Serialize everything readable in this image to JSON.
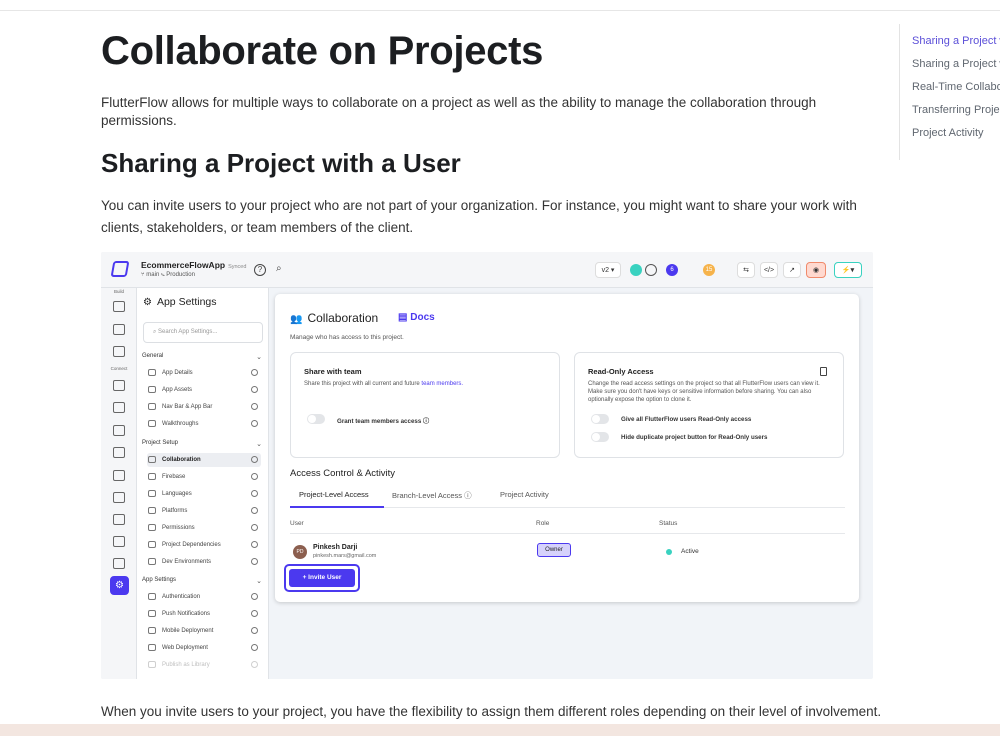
{
  "doc": {
    "title": "Collaborate on Projects",
    "intro": "FlutterFlow allows for multiple ways to collaborate on a project as well as the ability to manage the collaboration through permissions.",
    "section_title": "Sharing a Project with a User",
    "section_text": "You can invite users to your project who are not part of your organization. For instance, you might want to share your work with clients, stakeholders, or team members of the client.",
    "after_text": "When you invite users to your project, you have the flexibility to assign them different roles depending on their level of involvement."
  },
  "toc": {
    "items": [
      "Sharing a Project w",
      "Sharing a Project w",
      "Real-Time Collabor",
      "Transferring Projec",
      "Project Activity"
    ]
  },
  "app": {
    "name": "EcommerceFlowApp",
    "synced": "Synced",
    "branch": "main",
    "env": "Production",
    "version": "v2",
    "badge1": "6",
    "badge2": "15",
    "rail": {
      "build": "Build",
      "connect": "Connect"
    },
    "sidebar": {
      "title": "App Settings",
      "search_placeholder": "Search App Settings...",
      "sections": {
        "general": "General",
        "project_setup": "Project Setup",
        "app_settings": "App Settings"
      },
      "general_items": [
        "App Details",
        "App Assets",
        "Nav Bar & App Bar",
        "Walkthroughs"
      ],
      "setup_items": [
        "Collaboration",
        "Firebase",
        "Languages",
        "Platforms",
        "Permissions",
        "Project Dependencies",
        "Dev Environments"
      ],
      "app_items": [
        "Authentication",
        "Push Notifications",
        "Mobile Deployment",
        "Web Deployment",
        "Publish as Library"
      ]
    },
    "collab": {
      "title": "Collaboration",
      "docs": "Docs",
      "subtitle": "Manage who has access to this project.",
      "share": {
        "title": "Share with team",
        "text": "Share this project with all current and future",
        "link": "team members.",
        "toggle": "Grant team members access"
      },
      "readonly": {
        "title": "Read-Only Access",
        "text": "Change the read access settings on the project so that all FlutterFlow users can view it. Make sure you don't have keys or sensitive information before sharing. You can also optionally expose the option to clone it.",
        "toggle1": "Give all FlutterFlow users Read-Only access",
        "toggle2": "Hide duplicate project button for Read-Only users"
      },
      "access_title": "Access Control & Activity",
      "tabs": [
        "Project-Level Access",
        "Branch-Level Access",
        "Project Activity"
      ],
      "columns": [
        "User",
        "Role",
        "Status"
      ],
      "user": {
        "initials": "PD",
        "name": "Pinkesh Darji",
        "email": "pinkesh.mars@gmail.com",
        "role": "Owner",
        "status": "Active"
      },
      "invite": "Invite User"
    }
  }
}
